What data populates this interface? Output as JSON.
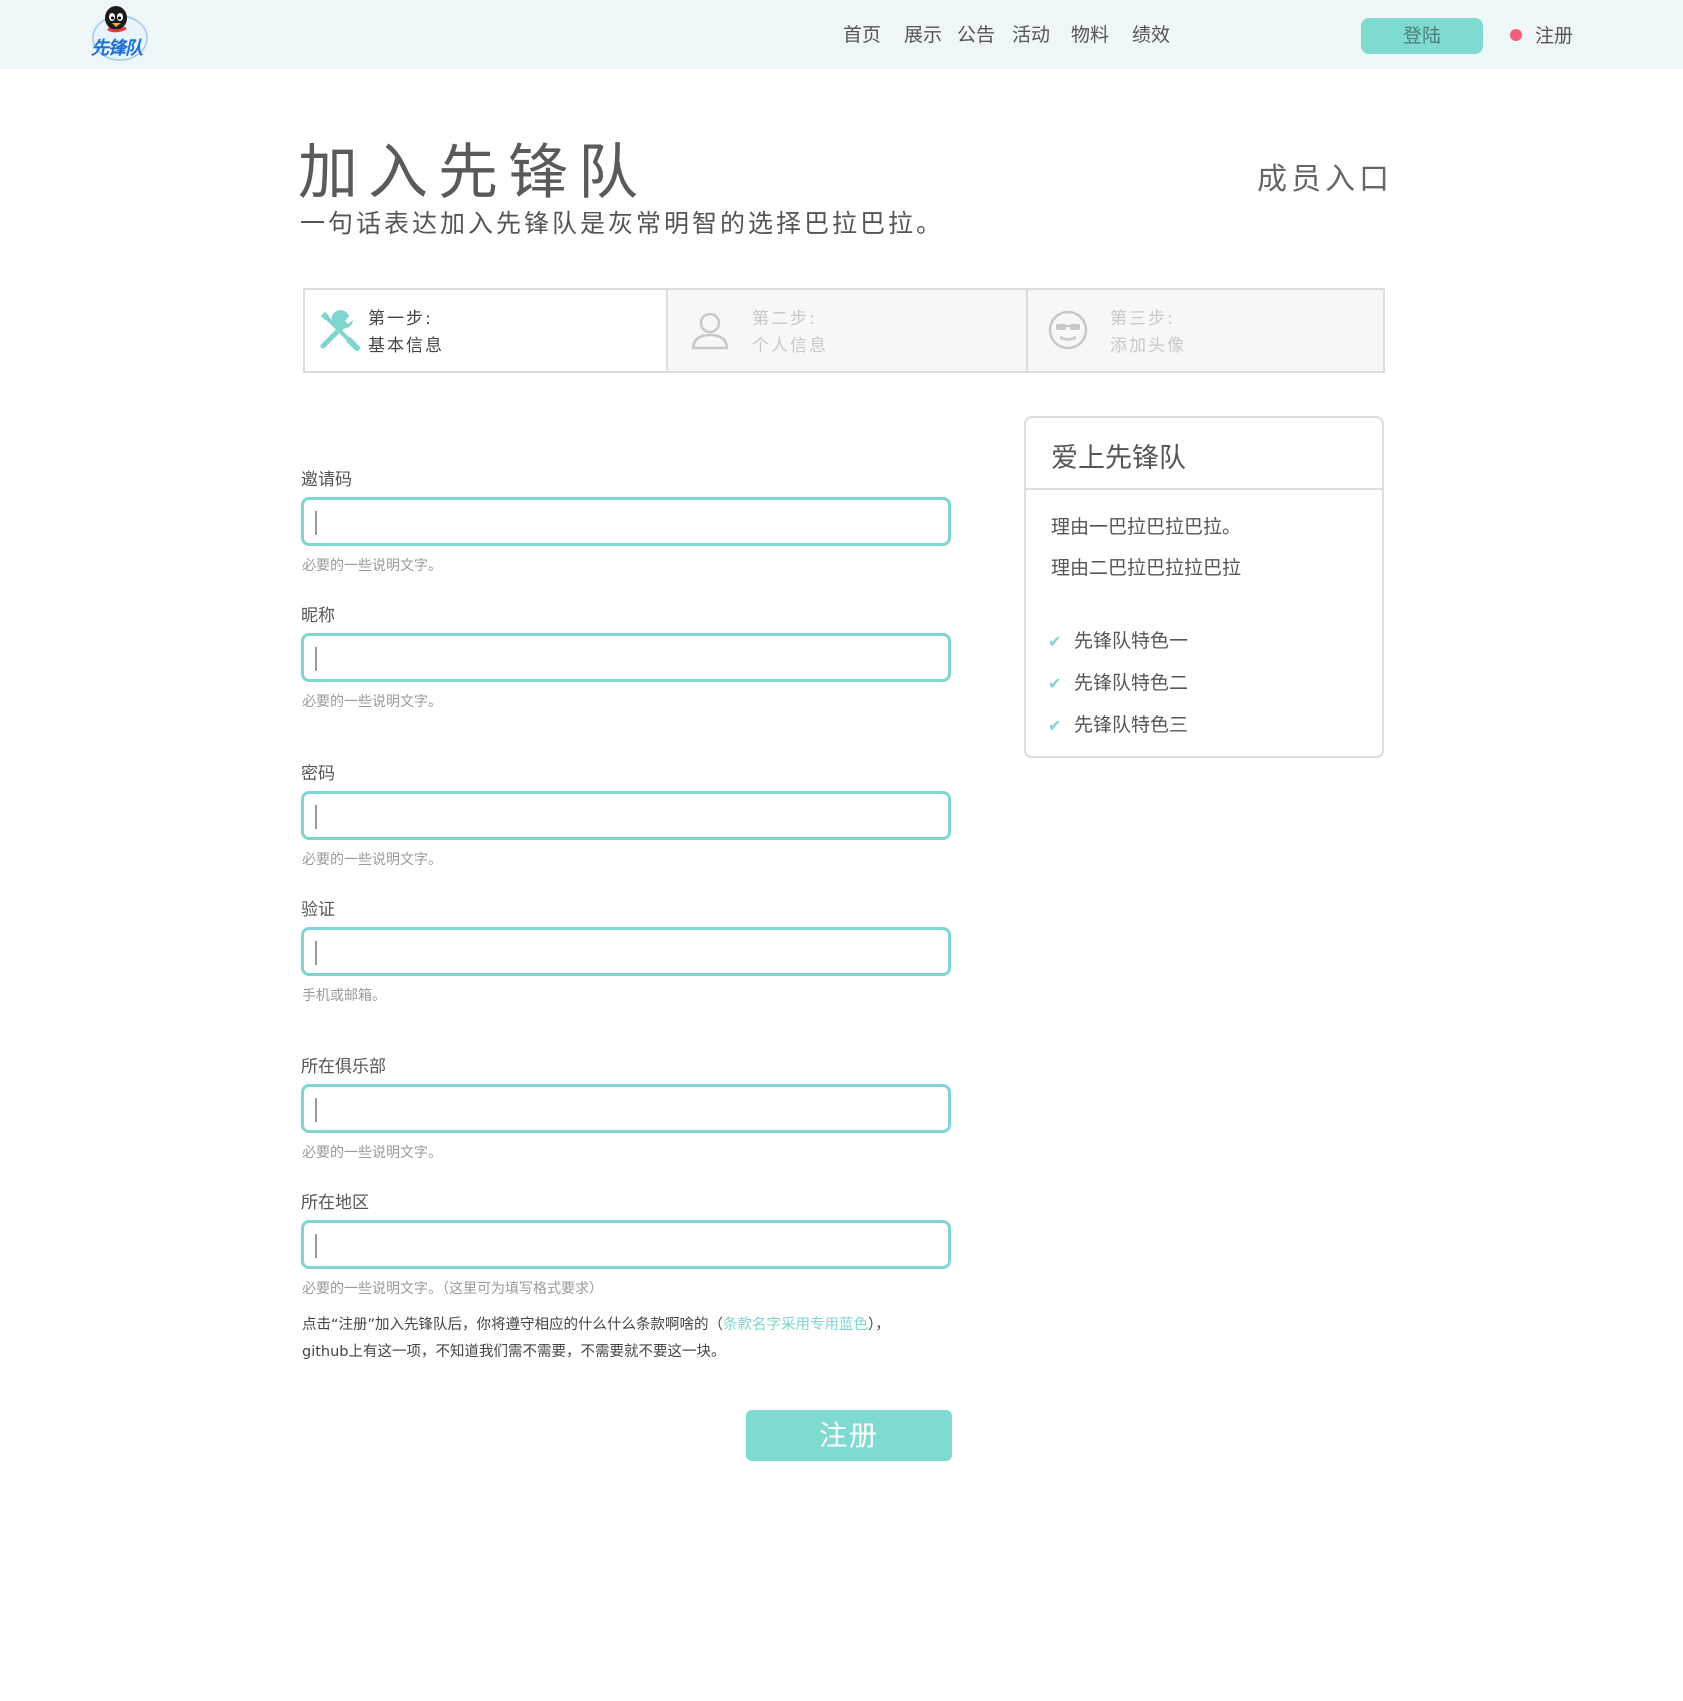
{
  "header": {
    "logo_text": "先锋队",
    "nav": [
      "首页",
      "展示",
      "公告",
      "活动",
      "物料",
      "绩效"
    ],
    "login_label": "登陆",
    "register_label": "注册",
    "colors": {
      "accent": "#7fdad2",
      "dot": "#ef5f7a",
      "bar": "#eef6f7"
    }
  },
  "page": {
    "title": "加入先锋队",
    "subtitle": "一句话表达加入先锋队是灰常明智的选择巴拉巴拉。",
    "member_entry": "成员入口"
  },
  "steps": [
    {
      "line1": "第一步:",
      "line2": "基本信息",
      "icon": "tools-icon",
      "active": true
    },
    {
      "line1": "第二步:",
      "line2": "个人信息",
      "icon": "user-icon",
      "active": false
    },
    {
      "line1": "第三步:",
      "line2": "添加头像",
      "icon": "cool-face-icon",
      "active": false
    }
  ],
  "form": {
    "fields": [
      {
        "label": "邀请码",
        "value": "",
        "help": "必要的一些说明文字。"
      },
      {
        "label": "昵称",
        "value": "",
        "help": "必要的一些说明文字。"
      },
      {
        "label": "密码",
        "value": "",
        "help": "必要的一些说明文字。"
      },
      {
        "label": "验证",
        "value": "",
        "help": "手机或邮箱。"
      },
      {
        "label": "所在俱乐部",
        "value": "",
        "help": "必要的一些说明文字。"
      },
      {
        "label": "所在地区",
        "value": "",
        "help": "必要的一些说明文字。（这里可为填写格式要求）"
      }
    ],
    "terms_before": "点击“注册”加入先锋队后，你将遵守相应的什么什么条款啊啥的（",
    "terms_link": "条款名字采用专用蓝色",
    "terms_after": "），",
    "terms_line2": "github上有这一项，不知道我们需不需要，不需要就不要这一块。",
    "submit_label": "注册"
  },
  "sidebar": {
    "title": "爱上先锋队",
    "reasons": [
      "理由一巴拉巴拉巴拉。",
      "理由二巴拉巴拉拉巴拉"
    ],
    "features": [
      "先锋队特色一",
      "先锋队特色二",
      "先锋队特色三"
    ]
  }
}
